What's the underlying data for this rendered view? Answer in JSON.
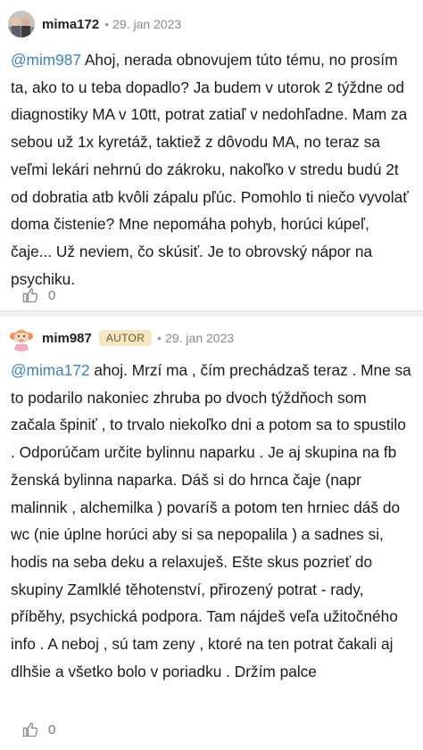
{
  "posts": [
    {
      "author": "mima172",
      "date": "29. jan 2023",
      "mention": "@mim987",
      "text": " Ahoj, nerada obnovujem túto tému, no prosím ta, ako to u teba dopadlo? Ja budem v utorok 2 týždne od diagnostiky MA v 10tt, potrat zatiaľ v nedohľadne. Mam za sebou už 1x kyretáž, taktiež z dôvodu MA, no teraz sa veľmi lekári nehrnú do zákroku, nakoľko v stredu budú 2t od dobratia atb kvôli zápalu pľúc. Pomohlo ti niečo vyvolať doma čistenie? Mne nepomáha pohyb, horúci kúpeľ, čaje... Už neviem, čo skúsiť. Je to obrovský nápor na psychiku.",
      "likes": "0"
    },
    {
      "author": "mim987",
      "badge": "AUTOR",
      "date": "29. jan 2023",
      "mention": "@mima172",
      "text": " ahoj. Mrzí ma , čím prechádzaš teraz . Mne sa to podarilo nakoniec zhruba po dvoch týždňoch som začala špiniť , to trvalo niekoľko dni a potom sa to spustilo . Odporúčam určite bylinnu naparku . Je aj skupina na fb ženská bylinna naparka. Dáš si do hrnca čaje (napr malinnik , alchemilka ) povaríš a potom ten hrniec dáš do wc (nie úplne horúci aby si sa nepopalila ) a sadnes si, hodis na seba deku a relaxuješ. Ešte skus pozrieť do skupiny Zamlklé těhotenství, přirozený potrat - rady, příběhy, psychická podpora. Tam nájdeš veľa užitočného info . A neboj , sú tam zeny , ktoré na ten potrat čakali aj dlhšie a všetko bolo v poriadku . Držím palce",
      "likes": "0"
    }
  ]
}
